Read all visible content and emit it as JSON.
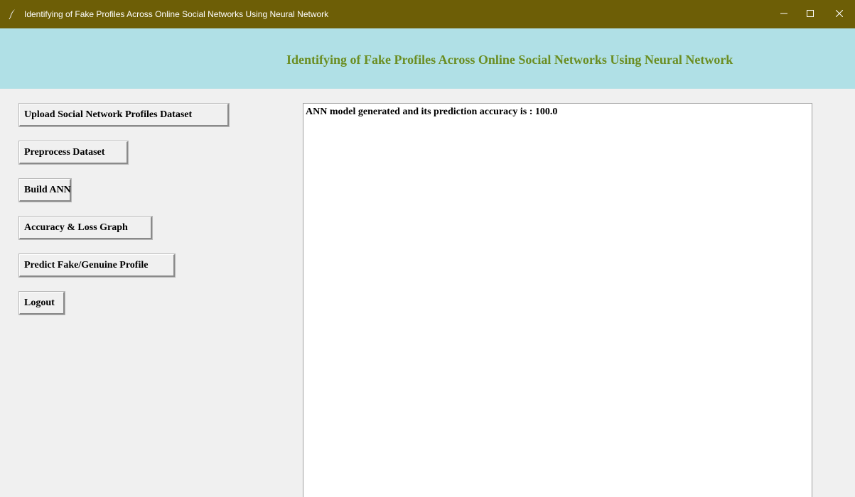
{
  "window": {
    "title": "Identifying of Fake Profiles Across Online Social Networks Using Neural Network",
    "app_icon": "feather-icon",
    "controls": {
      "minimize": "minimize-icon",
      "maximize": "maximize-icon",
      "close": "close-icon"
    },
    "titlebar_color": "#6d5e06"
  },
  "banner": {
    "heading": "Identifying of Fake Profiles Across Online Social Networks Using Neural Network",
    "background_color": "#b0e0e6",
    "heading_color": "#6b8e23"
  },
  "buttons": {
    "upload": "Upload Social Network Profiles Dataset",
    "preprocess": "Preprocess Dataset",
    "build": "Build ANN",
    "graph": "Accuracy & Loss Graph",
    "predict": "Predict Fake/Genuine Profile",
    "logout": "Logout"
  },
  "output": {
    "text": "ANN model generated and its prediction accuracy is : 100.0"
  }
}
